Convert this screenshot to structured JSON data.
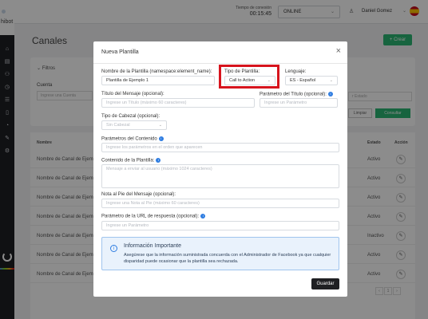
{
  "app": {
    "logo_text": "hibot"
  },
  "topbar": {
    "connection_label": "Tiempo de conexión",
    "connection_time": "00:15:45",
    "status_value": "ONLINE",
    "user_name": "Daniel Gomez"
  },
  "page": {
    "title": "Canales",
    "create_button": "+ Crear",
    "filters_title": "Filtros",
    "cuenta_label": "Cuenta",
    "cuenta_placeholder": "Ingrese una Cuenta",
    "estado_placeholder": "r Estado",
    "limpiar_button": "Limpiar",
    "consultar_button": "Consultar",
    "table": {
      "headers": {
        "nombre": "Nombre",
        "estado": "Estado",
        "accion": "Acción"
      },
      "rows": [
        {
          "name": "Nombre de Canal de Ejemp",
          "state": "Activo"
        },
        {
          "name": "Nombre de Canal de Ejemp",
          "state": "Activo"
        },
        {
          "name": "Nombre de Canal de Ejemp",
          "state": "Activo"
        },
        {
          "name": "Nombre de Canal de Ejemp",
          "state": "Activo"
        },
        {
          "name": "Nombre de Canal de Ejemp",
          "state": "Inactivo"
        },
        {
          "name": "Nombre de Canal de Ejemp",
          "state": "Activo"
        },
        {
          "name": "Nombre de Canal de Ejemp",
          "state": "Activo"
        }
      ]
    },
    "pager": {
      "current": "1"
    }
  },
  "modal": {
    "title": "Nueva Plantilla",
    "nombre_label": "Nombre de la Plantilla (namespace:element_name):",
    "nombre_value": "Plantilla de Ejemplo 1",
    "tipo_label": "Tipo de Plantilla:",
    "tipo_value": "Call to Action",
    "lenguaje_label": "Lenguaje:",
    "lenguaje_value": "ES - Español",
    "titulo_label": "Título del Mensaje (opcional):",
    "titulo_placeholder": "Ingrese un Título (máximo 60 caracteres)",
    "param_titulo_label": "Parámetro del Título (opcional):",
    "param_titulo_placeholder": "Ingrese un Parámetro",
    "cabezal_label": "Tipo de Cabezal (opcional):",
    "cabezal_value": "Sin Cabezal",
    "param_contenido_label": "Parámetros del Contenido",
    "param_contenido_placeholder": "Ingrese los parámetros en el orden que aparecen",
    "contenido_label": "Contenido de la Plantilla:",
    "contenido_placeholder": "Mensaje a enviar al usuario (máximo 1024 caracteres)",
    "pie_label": "Nota al Pie del Mensaje (opcional):",
    "pie_placeholder": "Ingrese una Nota al Pie (máximo 60 caracteres)",
    "url_label": "Parámetro de la URL de respuesta (opcional):",
    "url_placeholder": "Ingrese un Parámetro",
    "info_title": "Información Importante",
    "info_text": "Asegúrese que la información suministrada concuerda con el Administrador de Facebook ya que cualquier disparidad puede ocasionar que la plantilla sea rechazada.",
    "save_button": "Guardar"
  },
  "colors": {
    "accent_green": "#2bb673",
    "highlight_red": "#d7141d",
    "info_blue": "#2f7de1",
    "dark_button": "#1f2023"
  }
}
